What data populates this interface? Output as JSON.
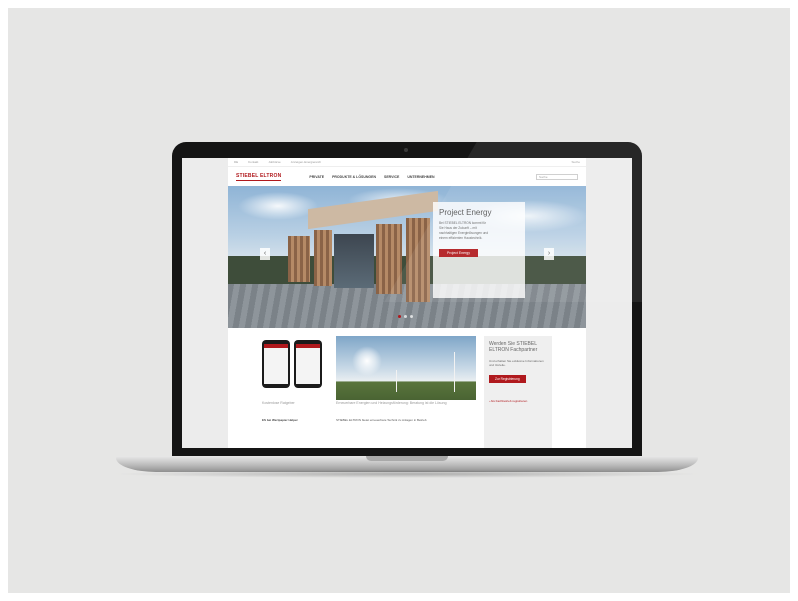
{
  "site": {
    "topbar": [
      "DE",
      "Kontakt",
      "Jobbörse",
      "Anzeigen-Energiereich"
    ],
    "top_search": "Suche",
    "logo": "STIEBEL ELTRON",
    "nav": [
      "PRIVATE",
      "PRODUKTE & LÖSUNGEN",
      "SERVICE",
      "UNTERNEHMEN"
    ],
    "nav_search_placeholder": "Suche",
    "hero": {
      "title": "Project Energy",
      "text": "Bei STIEBEL ELTRON kommt für Sie Haus der Zukunft – mit nachhaltigen Energielösungen und einem effizienten Haustechnik.",
      "button": "Project Energy",
      "prev": "‹",
      "next": "›"
    },
    "col1": {
      "title": "Kostenlose Ratgeber",
      "text": "ES bei Wertpapier Helper"
    },
    "col2": {
      "title": "Erneuerbare Energien und Heizungsförderung: Beratung ist die Lösung",
      "text": "STIEBEL ELTRON bietet erneuerbare Technik zu Anlagen in Betrieb"
    },
    "partner": {
      "title": "Werden Sie STIEBEL ELTRON Fachpartner",
      "text": "Und erhalten Sie exklusive Informationen und Vorteile.",
      "button": "Zur Registrierung",
      "link": "› Als Fachbetrieb registrieren"
    }
  }
}
